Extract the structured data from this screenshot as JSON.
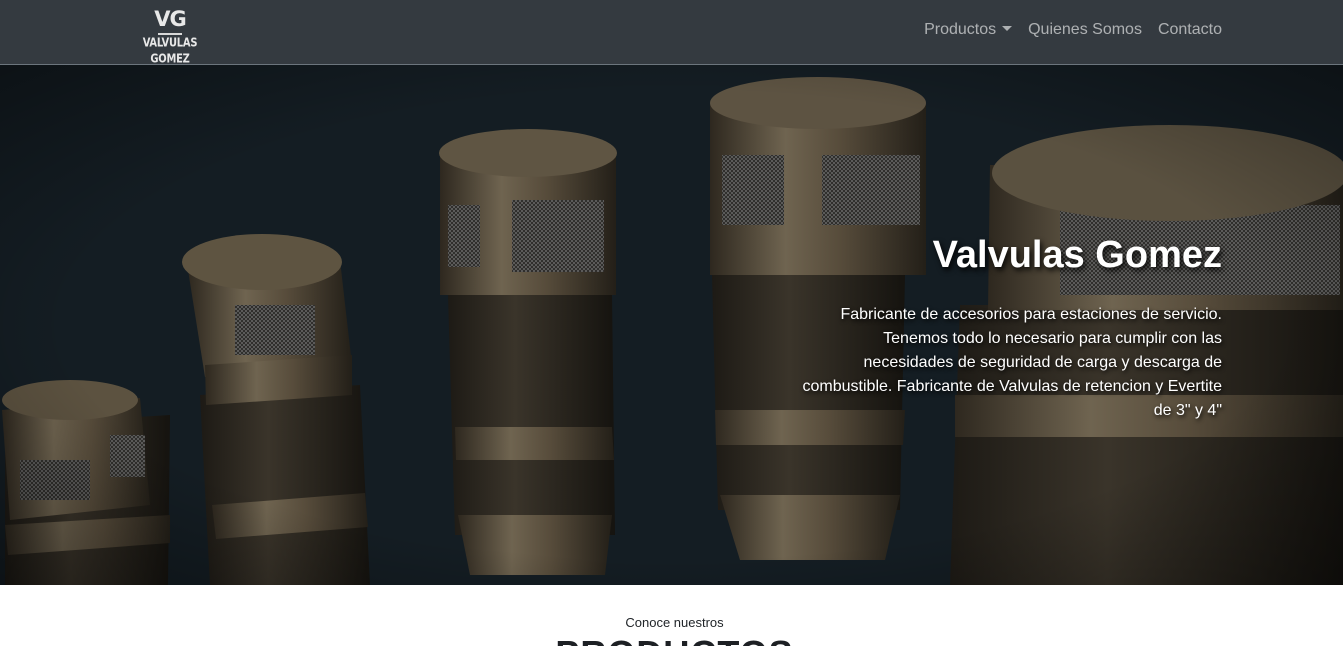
{
  "navbar": {
    "logo": {
      "monogram": "VG",
      "name": "VALVULAS GOMEZ"
    },
    "links": [
      {
        "label": "Productos",
        "dropdown": true
      },
      {
        "label": "Quienes Somos",
        "dropdown": false
      },
      {
        "label": "Contacto",
        "dropdown": false
      }
    ]
  },
  "hero": {
    "title": "Valvulas Gomez",
    "description": "Fabricante de accesorios para estaciones de servicio. Tenemos todo lo necesario para cumplir con las necesidades de seguridad de carga y descarga de combustible. Fabricante de Valvulas de retencion y Evertite de 3\" y 4\""
  },
  "products": {
    "subtitle": "Conoce nuestros",
    "title": "PRODUCTOS"
  },
  "colors": {
    "navbar_bg": "#343a40",
    "hero_bg": "#131c22",
    "valve_metal": "#6b5f49",
    "nav_link": "rgba(255,255,255,0.6)"
  },
  "icons": [
    "dropdown-caret-icon"
  ]
}
